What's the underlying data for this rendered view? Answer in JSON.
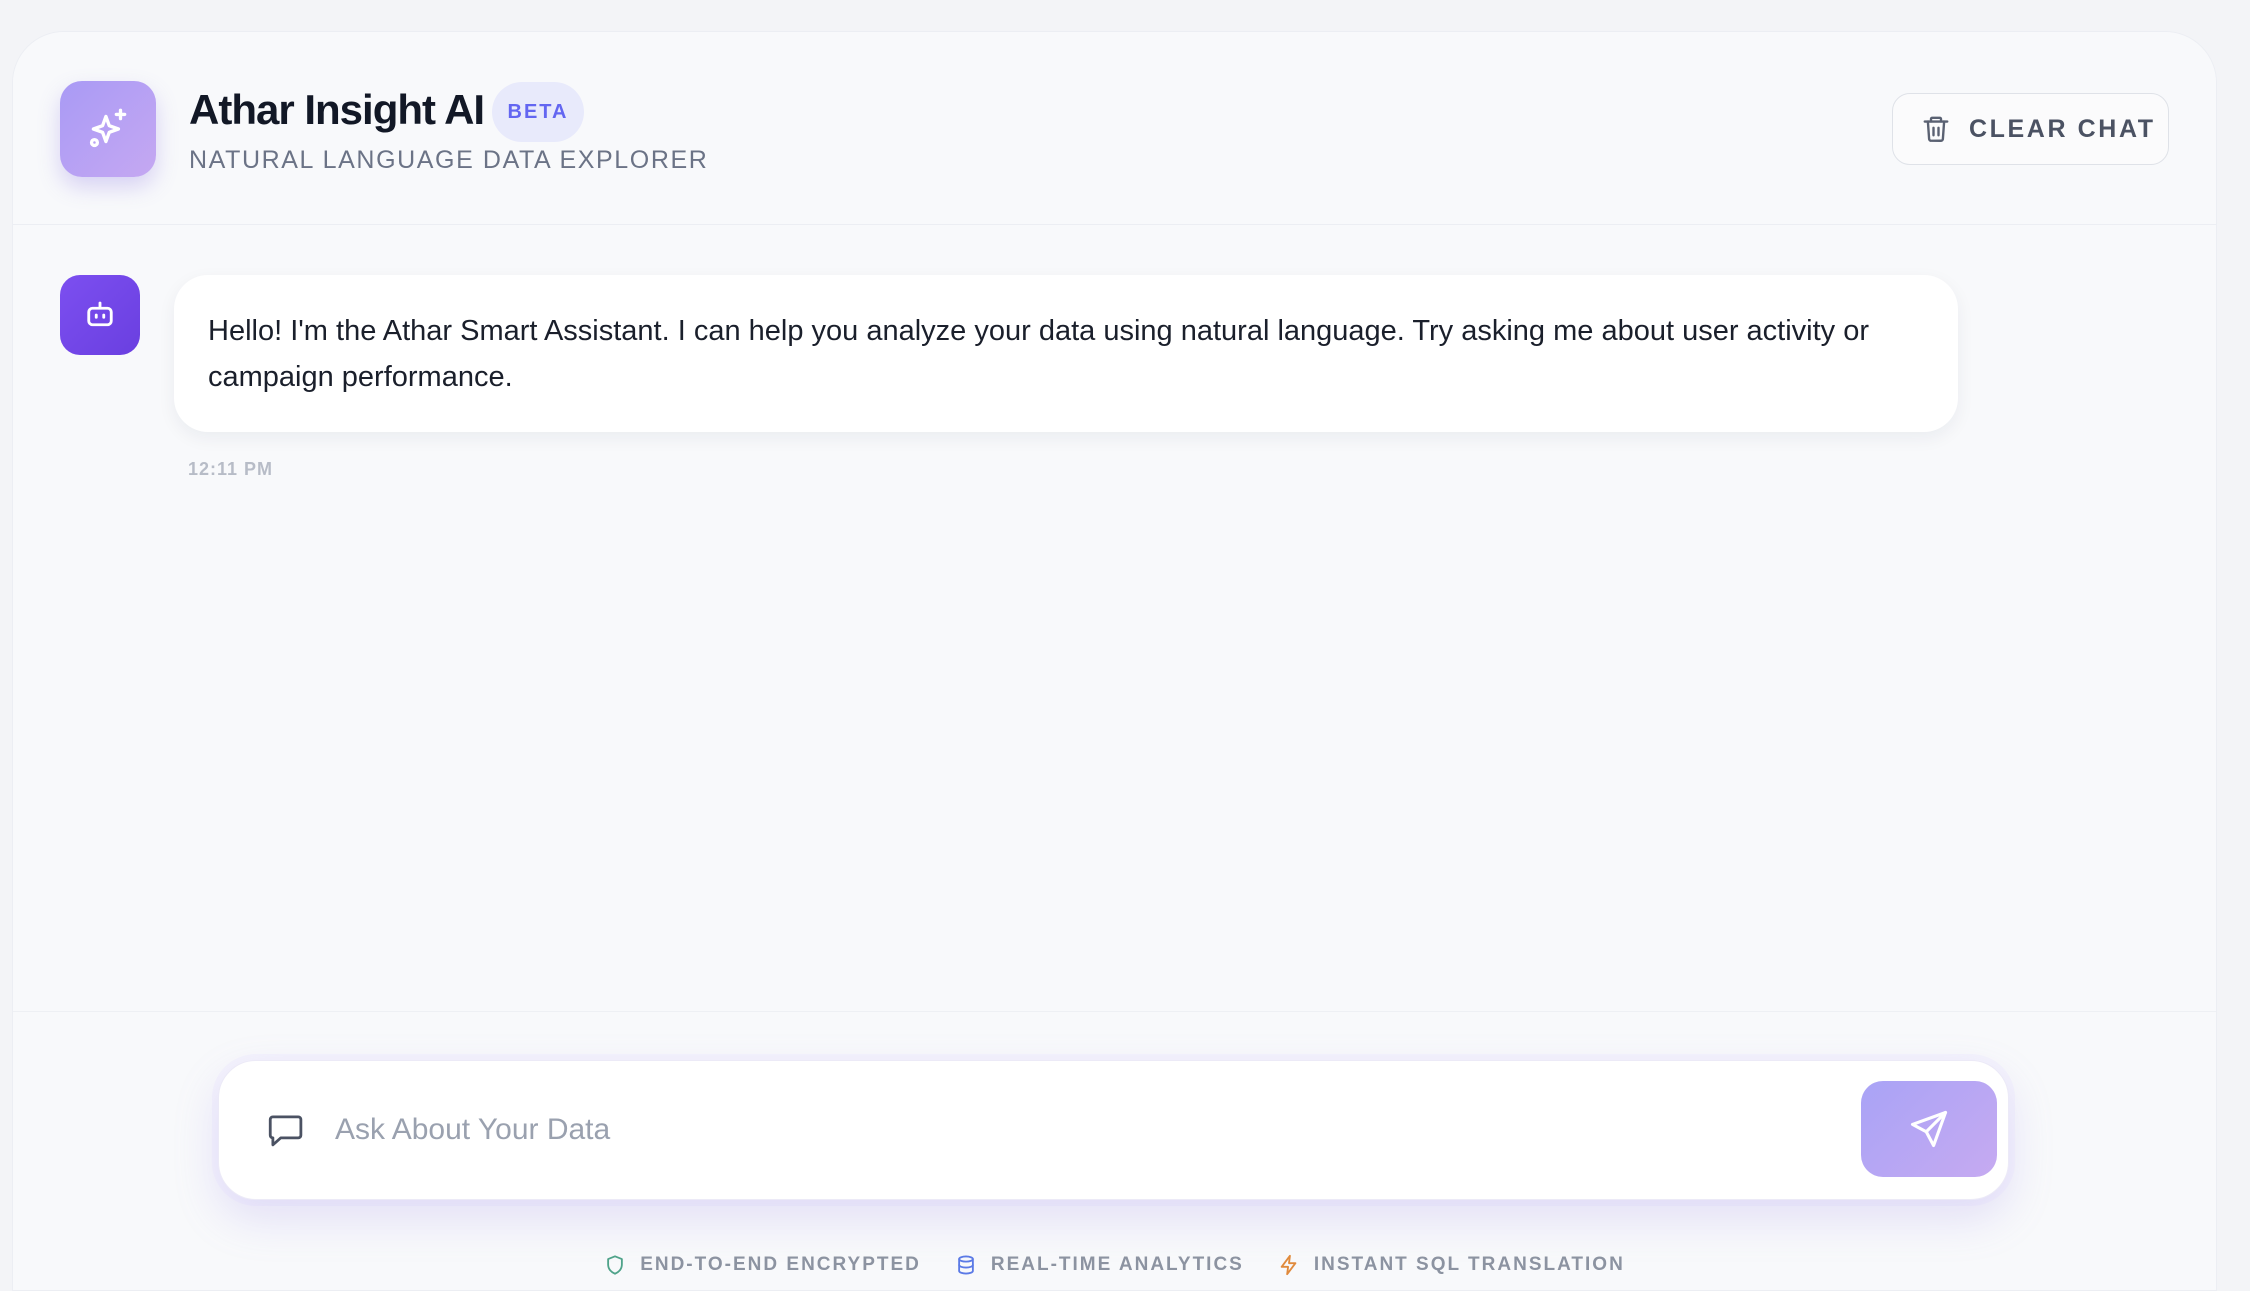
{
  "header": {
    "title": "Athar Insight AI",
    "badge": "BETA",
    "subtitle": "NATURAL LANGUAGE DATA EXPLORER",
    "clear_label": "CLEAR CHAT",
    "logo_icon": "sparkles-icon"
  },
  "chat": {
    "messages": [
      {
        "role": "assistant",
        "text": "Hello! I'm the Athar Smart Assistant. I can help you analyze your data using natural language. Try asking me about user activity or campaign performance.",
        "time": "12:11 PM",
        "avatar_icon": "bot-icon"
      }
    ]
  },
  "composer": {
    "placeholder": "Ask About Your Data",
    "value": "",
    "send_icon": "send-icon",
    "leading_icon": "message-square-icon"
  },
  "features": [
    {
      "label": "END-TO-END ENCRYPTED",
      "icon": "shield-icon",
      "color": "#4fa38a"
    },
    {
      "label": "REAL-TIME ANALYTICS",
      "icon": "database-icon",
      "color": "#5b7ae6"
    },
    {
      "label": "INSTANT SQL TRANSLATION",
      "icon": "zap-icon",
      "color": "#e08a3c"
    }
  ],
  "colors": {
    "accent": "#6366f1",
    "logo_gradient_start": "#a99af5",
    "logo_gradient_end": "#c5a8f2",
    "avatar": "#7c4ff0",
    "background": "#f8f9fb"
  }
}
